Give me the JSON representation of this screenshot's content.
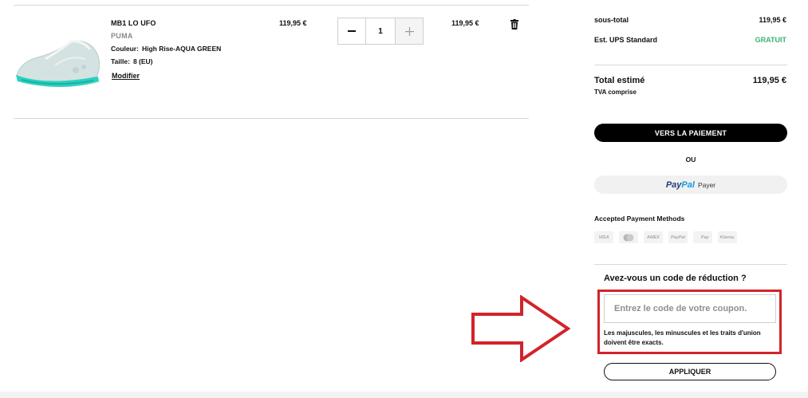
{
  "item": {
    "name": "MB1 LO UFO",
    "brand": "PUMA",
    "color_label": "Couleur:",
    "color_value": "High Rise-AQUA GREEN",
    "size_label": "Taille:",
    "size_value": "8 (EU)",
    "modify_label": "Modifier",
    "unit_price": "119,95 €",
    "quantity": "1",
    "line_total": "119,95 €",
    "icons": {
      "minus": "minus-icon",
      "plus": "plus-icon",
      "trash": "trash-icon"
    }
  },
  "summary": {
    "subtotal_label": "sous-total",
    "subtotal_value": "119,95 €",
    "shipping_label": "Est. UPS Standard",
    "shipping_value": "GRATUIT",
    "total_label": "Total estimé",
    "total_value": "119,95 €",
    "vat_note": "TVA comprise",
    "checkout_label": "VERS LA PAIEMENT",
    "or_label": "OU",
    "paypal_brand_1": "Pay",
    "paypal_brand_2": "Pal",
    "paypal_pay_label": "Payer",
    "payment_methods_title": "Accepted Payment Methods",
    "payment_methods": [
      "VISA",
      "MC",
      "AMEX",
      "PayPal",
      " Pay",
      "Klarna."
    ]
  },
  "discount": {
    "title": "Avez-vous un code de réduction ?",
    "placeholder": "Entrez le code de votre coupon.",
    "value": "",
    "hint": "Les majuscules, les minuscules et les traits d'union doivent être exacts.",
    "apply_label": "APPLIQUER"
  },
  "colors": {
    "accent_black": "#000000",
    "free_green": "#3db36f",
    "highlight_red": "#d2232a",
    "paypal_dark": "#253b80",
    "paypal_light": "#179bd7"
  }
}
